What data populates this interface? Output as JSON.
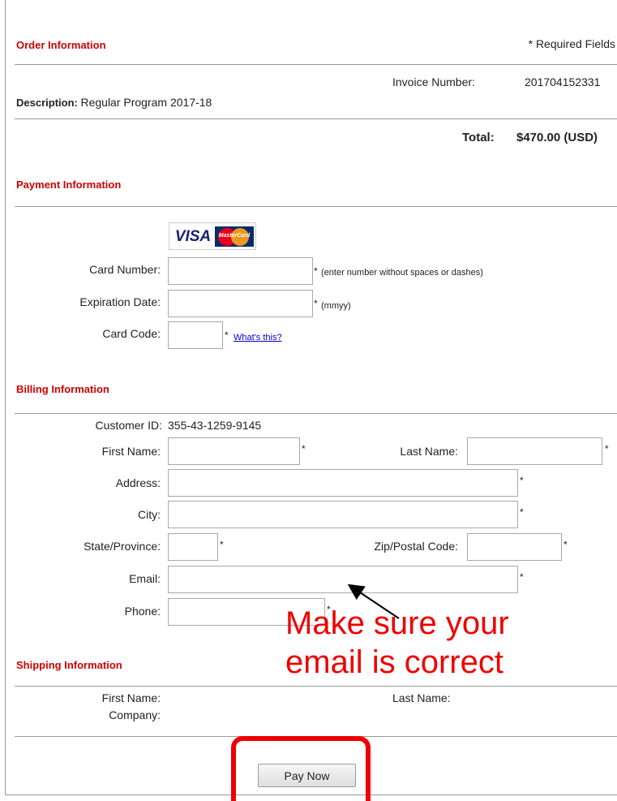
{
  "order": {
    "heading": "Order Information",
    "required_note": "* Required Fields",
    "invoice_label": "Invoice Number:",
    "invoice_value": "201704152331",
    "description_label": "Description:",
    "description_value": "Regular Program 2017-18",
    "total_label": "Total:",
    "total_value": "$470.00 (USD)"
  },
  "payment": {
    "heading": "Payment Information",
    "card_logos": [
      "VISA",
      "MasterCard"
    ],
    "card_number_label": "Card Number:",
    "card_number_hint": "(enter number without spaces or dashes)",
    "expiration_label": "Expiration Date:",
    "expiration_hint": "(mmyy)",
    "card_code_label": "Card Code:",
    "card_code_link": "What's this?"
  },
  "billing": {
    "heading": "Billing Information",
    "customer_id_label": "Customer ID:",
    "customer_id_value": "355-43-1259-9145",
    "first_name_label": "First Name:",
    "last_name_label": "Last Name:",
    "address_label": "Address:",
    "city_label": "City:",
    "state_label": "State/Province:",
    "zip_label": "Zip/Postal Code:",
    "email_label": "Email:",
    "phone_label": "Phone:",
    "required_star": "*"
  },
  "shipping": {
    "heading": "Shipping Information",
    "first_name_label": "First Name:",
    "last_name_label": "Last Name:",
    "company_label": "Company:"
  },
  "submit": {
    "label": "Pay Now"
  },
  "annotation": {
    "line1": "Make sure your",
    "line2": "email is correct",
    "color": "#ee0000"
  },
  "colors": {
    "section_heading": "#d00000",
    "link": "#0000cc"
  }
}
